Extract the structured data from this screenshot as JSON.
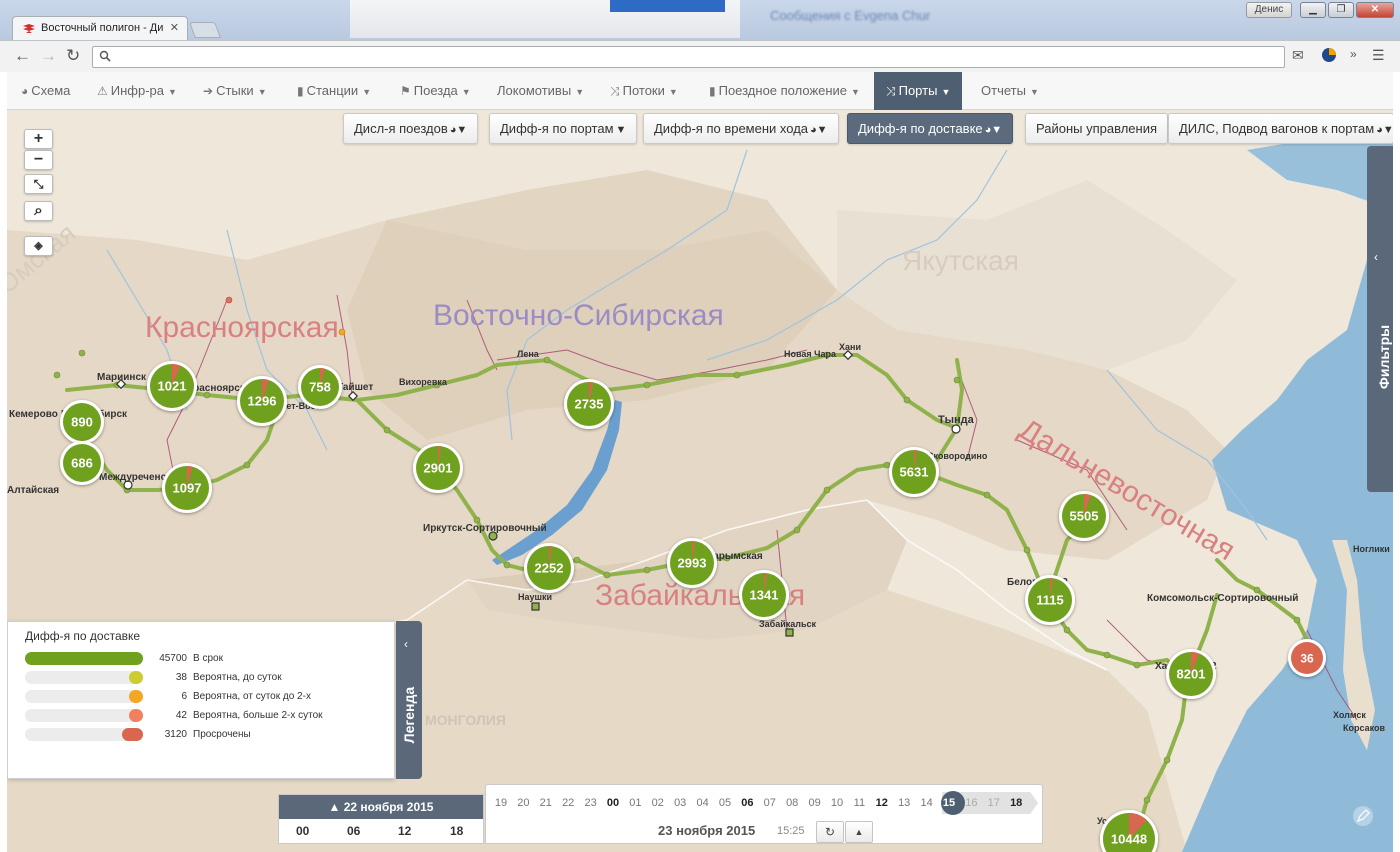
{
  "browser": {
    "tab_title": "Восточный полигон - Ди",
    "tab_close": "✕",
    "window_user": "Денис",
    "window_buttons": [
      "▁",
      "❐",
      "✕"
    ],
    "address": "",
    "background_titles": [
      "Сообщения с Evgena Chur"
    ]
  },
  "nav": {
    "items": [
      {
        "icon": "globe-icon",
        "glyph": "◕",
        "label": "Схема",
        "caret": ""
      },
      {
        "icon": "warning-icon",
        "glyph": "⚠",
        "label": "Инфр-ра",
        "caret": "▼"
      },
      {
        "icon": "arrow-right-icon",
        "glyph": "➔",
        "label": "Стыки",
        "caret": "▼"
      },
      {
        "icon": "bar-chart-icon",
        "glyph": "▮",
        "label": "Станции",
        "caret": "▼"
      },
      {
        "icon": "flag-icon",
        "glyph": "⚑",
        "label": "Поезда",
        "caret": "▼"
      },
      {
        "icon": "",
        "glyph": "",
        "label": "Локомотивы",
        "caret": "▼"
      },
      {
        "icon": "shuffle-icon",
        "glyph": "⤨",
        "label": "Потоки",
        "caret": "▼"
      },
      {
        "icon": "bar-chart-icon",
        "glyph": "▮",
        "label": "Поездное положение",
        "caret": "▼"
      },
      {
        "icon": "shuffle-icon",
        "glyph": "⤨",
        "label": "Порты",
        "caret": "▼"
      },
      {
        "icon": "",
        "glyph": "",
        "label": "Отчеты",
        "caret": "▼"
      }
    ],
    "active_index": 8
  },
  "layers": {
    "buttons": [
      {
        "label": "Дисл-я поездов",
        "icons": "◕▼"
      },
      {
        "label": "Дифф-я по портам",
        "icons": "▼"
      },
      {
        "label": "Дифф-я по времени хода",
        "icons": "◕▼"
      },
      {
        "label": "Дифф-я по доставке",
        "icons": "◕▼"
      },
      {
        "label": "Районы управления",
        "icons": ""
      },
      {
        "label": "ДИЛС, Подвод вагонов к портам",
        "icons": "◕▼"
      }
    ],
    "active_index": 3
  },
  "map_controls": {
    "zoom_in": "+",
    "zoom_out": "−",
    "fit": "⤡",
    "search": "⌕",
    "eye": "◈"
  },
  "filters_panel": {
    "label": "Фильтры",
    "chevron": "‹"
  },
  "regions": [
    {
      "name": "Красноярская",
      "color": "#d98080"
    },
    {
      "name": "Восточно-Сибирская",
      "color": "#9a8cc4"
    },
    {
      "name": "Якутская",
      "color": "#d6ccc0"
    },
    {
      "name": "Забайкальская",
      "color": "#d98080"
    },
    {
      "name": "Дальневосточная",
      "color": "#d98080"
    },
    {
      "name": "МОНГОЛИЯ",
      "color": "#cfc4b8"
    },
    {
      "name": "Омская",
      "color": "#d6ccc0"
    }
  ],
  "stations": [
    "Мариинск",
    "Красноярск",
    "Кемерово",
    "Новосибирск",
    "Алтайская",
    "Междуреченск",
    "Тайшет",
    "Вихоревка",
    "Лена",
    "Новая Чара",
    "Хани",
    "Тында",
    "Тайшет-Вост.",
    "Иркутск-Сортировочный",
    "Наушки",
    "Карымская",
    "Забайкальск",
    "Белогорск-2",
    "Комсомольск-Сортировочный",
    "Хабаровск-2",
    "Ноглики",
    "Холмск",
    "Корсаков",
    "Уссурийск",
    "Сковородино"
  ],
  "clusters": [
    {
      "value": "1021",
      "late_share": 0.06
    },
    {
      "value": "1296",
      "late_share": 0.05
    },
    {
      "value": "758",
      "late_share": 0.04
    },
    {
      "value": "890",
      "late_share": 0
    },
    {
      "value": "686",
      "late_share": 0
    },
    {
      "value": "1097",
      "late_share": 0.04
    },
    {
      "value": "2901",
      "late_share": 0.02
    },
    {
      "value": "2735",
      "late_share": 0.03
    },
    {
      "value": "2252",
      "late_share": 0.02
    },
    {
      "value": "2993",
      "late_share": 0.02
    },
    {
      "value": "1341",
      "late_share": 0.02
    },
    {
      "value": "5631",
      "late_share": 0.02
    },
    {
      "value": "5505",
      "late_share": 0.05
    },
    {
      "value": "1115",
      "late_share": 0.02
    },
    {
      "value": "8201",
      "late_share": 0.06
    },
    {
      "value": "36",
      "late_share": 1
    },
    {
      "value": "10448",
      "late_share": 0.12
    }
  ],
  "legend": {
    "title": "Дифф-я по доставке",
    "tab_label": "Легенда",
    "chevron": "‹",
    "rows": [
      {
        "count": "45700",
        "label": "В срок",
        "color": "#6fa01e",
        "fill": 1.0
      },
      {
        "count": "38",
        "label": "Вероятна, до суток",
        "color": "#cccc33",
        "fill": 0.12
      },
      {
        "count": "6",
        "label": "Вероятна, от суток до 2-х",
        "color": "#f5a623",
        "fill": 0.12
      },
      {
        "count": "42",
        "label": "Вероятна, больше 2-х суток",
        "color": "#f08060",
        "fill": 0.12
      },
      {
        "count": "3120",
        "label": "Просрочены",
        "color": "#d9664f",
        "fill": 0.18
      }
    ]
  },
  "time": {
    "prev_day": {
      "label": "▲ 22 ноября 2015",
      "hours": [
        "00",
        "06",
        "12",
        "18"
      ]
    },
    "hours": [
      {
        "h": "19",
        "state": "past"
      },
      {
        "h": "20",
        "state": "past"
      },
      {
        "h": "21",
        "state": "past"
      },
      {
        "h": "22",
        "state": "past"
      },
      {
        "h": "23",
        "state": "past"
      },
      {
        "h": "00",
        "state": "bold"
      },
      {
        "h": "01",
        "state": "past"
      },
      {
        "h": "02",
        "state": "past"
      },
      {
        "h": "03",
        "state": "past"
      },
      {
        "h": "04",
        "state": "past"
      },
      {
        "h": "05",
        "state": "past"
      },
      {
        "h": "06",
        "state": "bold"
      },
      {
        "h": "07",
        "state": "past"
      },
      {
        "h": "08",
        "state": "past"
      },
      {
        "h": "09",
        "state": "past"
      },
      {
        "h": "10",
        "state": "past"
      },
      {
        "h": "11",
        "state": "past"
      },
      {
        "h": "12",
        "state": "bold"
      },
      {
        "h": "13",
        "state": "past"
      },
      {
        "h": "14",
        "state": "past"
      },
      {
        "h": "15",
        "state": "current"
      },
      {
        "h": "16",
        "state": "future"
      },
      {
        "h": "17",
        "state": "future"
      },
      {
        "h": "18",
        "state": "bold"
      }
    ],
    "date": "23 ноября 2015",
    "clock": "15:25",
    "refresh": "↻",
    "up": "▲"
  },
  "colors": {
    "on_time": "#6fa01e",
    "late": "#d9664f",
    "water": "#8fbbd9",
    "nav_active": "#4f5f72",
    "route": "#8fb24a",
    "secondary_route": "#a0406a"
  }
}
